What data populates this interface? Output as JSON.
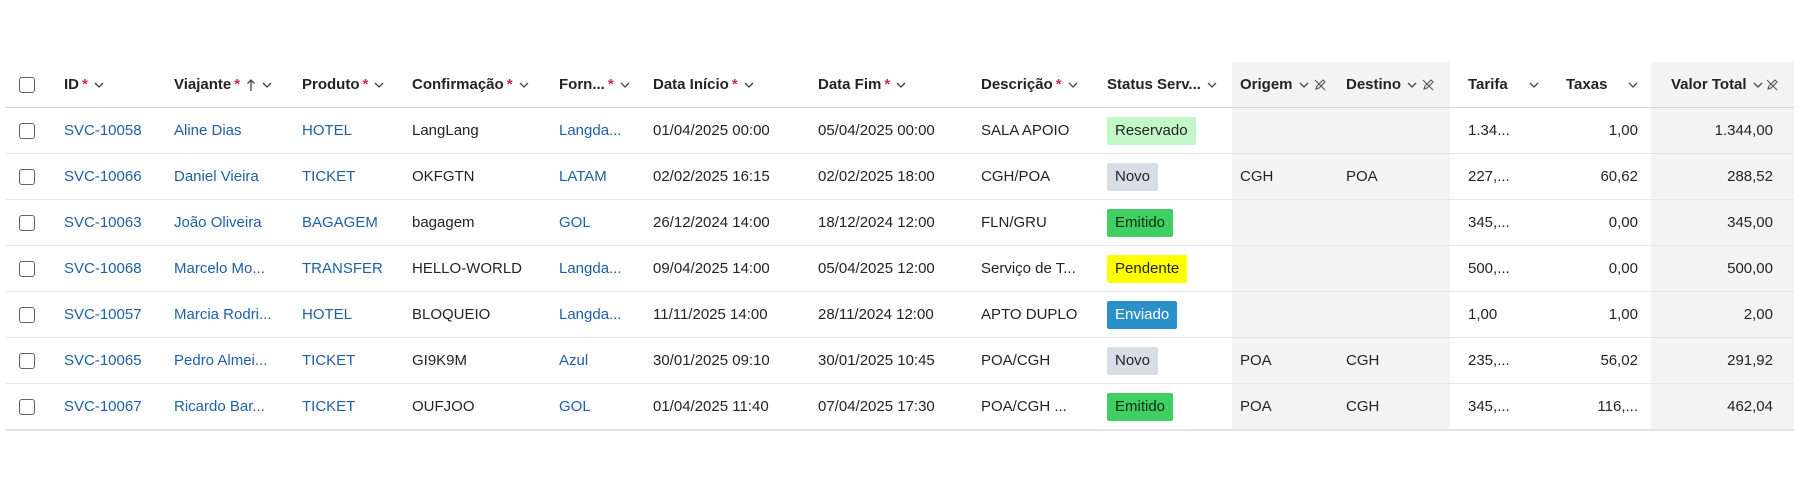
{
  "columns": {
    "id": "ID",
    "viajante": "Viajante",
    "produto": "Produto",
    "confirmacao": "Confirmação",
    "fornecedor": "Forn...",
    "data_inicio": "Data Início",
    "data_fim": "Data Fim",
    "descricao": "Descrição",
    "status": "Status Serv...",
    "origem": "Origem",
    "destino": "Destino",
    "tarifa": "Tarifa",
    "taxas": "Taxas",
    "valor_total": "Valor Total"
  },
  "required_mark": "*",
  "rows": [
    {
      "id": "SVC-10058",
      "viajante": "Aline Dias",
      "produto": "HOTEL",
      "confirmacao": "LangLang",
      "fornecedor": "Langda...",
      "data_inicio": "01/04/2025 00:00",
      "data_fim": "05/04/2025 00:00",
      "descricao": "SALA APOIO",
      "status": "Reservado",
      "status_bg": "#c3f7c8",
      "status_fg": "#242424",
      "origem": "",
      "destino": "",
      "tarifa": "1.34...",
      "taxas": "1,00",
      "valor_total": "1.344,00"
    },
    {
      "id": "SVC-10066",
      "viajante": "Daniel Vieira",
      "produto": "TICKET",
      "confirmacao": "OKFGTN",
      "fornecedor": "LATAM",
      "data_inicio": "02/02/2025 16:15",
      "data_fim": "02/02/2025 18:00",
      "descricao": "CGH/POA",
      "status": "Novo",
      "status_bg": "#d7dde6",
      "status_fg": "#242424",
      "origem": "CGH",
      "destino": "POA",
      "tarifa": "227,...",
      "taxas": "60,62",
      "valor_total": "288,52"
    },
    {
      "id": "SVC-10063",
      "viajante": "João Oliveira",
      "produto": "BAGAGEM",
      "confirmacao": "bagagem",
      "fornecedor": "GOL",
      "data_inicio": "26/12/2024 14:00",
      "data_fim": "18/12/2024 12:00",
      "descricao": "FLN/GRU",
      "status": "Emitido",
      "status_bg": "#3fcf62",
      "status_fg": "#0b2e13",
      "origem": "",
      "destino": "",
      "tarifa": "345,...",
      "taxas": "0,00",
      "valor_total": "345,00"
    },
    {
      "id": "SVC-10068",
      "viajante": "Marcelo Mo...",
      "produto": "TRANSFER",
      "confirmacao": "HELLO-WORLD",
      "fornecedor": "Langda...",
      "data_inicio": "09/04/2025 14:00",
      "data_fim": "05/04/2025 12:00",
      "descricao": "Serviço de T...",
      "status": "Pendente",
      "status_bg": "#ffff00",
      "status_fg": "#242424",
      "origem": "",
      "destino": "",
      "tarifa": "500,...",
      "taxas": "0,00",
      "valor_total": "500,00"
    },
    {
      "id": "SVC-10057",
      "viajante": "Marcia Rodri...",
      "produto": "HOTEL",
      "confirmacao": "BLOQUEIO",
      "fornecedor": "Langda...",
      "data_inicio": "11/11/2025 14:00",
      "data_fim": "28/11/2024 12:00",
      "descricao": "APTO DUPLO",
      "status": "Enviado",
      "status_bg": "#2b8fc9",
      "status_fg": "#ffffff",
      "origem": "",
      "destino": "",
      "tarifa": "1,00",
      "taxas": "1,00",
      "valor_total": "2,00"
    },
    {
      "id": "SVC-10065",
      "viajante": "Pedro Almei...",
      "produto": "TICKET",
      "confirmacao": "GI9K9M",
      "fornecedor": "Azul",
      "data_inicio": "30/01/2025 09:10",
      "data_fim": "30/01/2025 10:45",
      "descricao": "POA/CGH",
      "status": "Novo",
      "status_bg": "#d7dde6",
      "status_fg": "#242424",
      "origem": "POA",
      "destino": "CGH",
      "tarifa": "235,...",
      "taxas": "56,02",
      "valor_total": "291,92"
    },
    {
      "id": "SVC-10067",
      "viajante": "Ricardo Bar...",
      "produto": "TICKET",
      "confirmacao": "OUFJOO",
      "fornecedor": "GOL",
      "data_inicio": "01/04/2025 11:40",
      "data_fim": "07/04/2025 17:30",
      "descricao": "POA/CGH ...",
      "status": "Emitido",
      "status_bg": "#3fcf62",
      "status_fg": "#0b2e13",
      "origem": "POA",
      "destino": "CGH",
      "tarifa": "345,...",
      "taxas": "116,...",
      "valor_total": "462,04"
    }
  ],
  "icons": {
    "sort": "arrow-up-icon",
    "chevron": "chevron-down-icon",
    "edit": "pencil-off-icon"
  }
}
